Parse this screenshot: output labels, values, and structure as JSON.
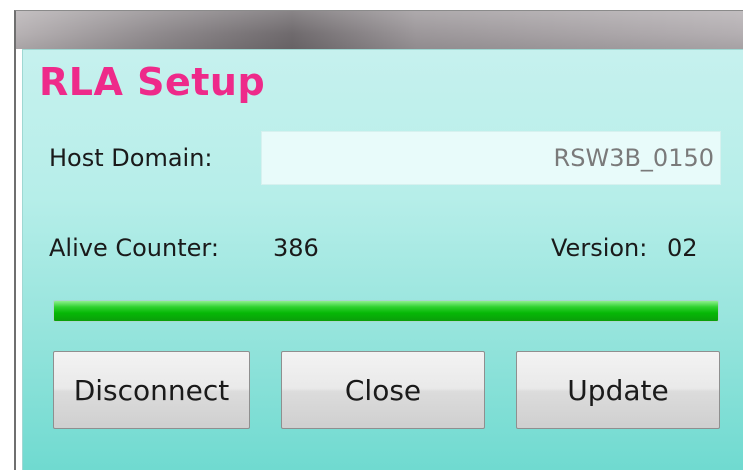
{
  "app": {
    "title": "RLA Setup"
  },
  "host": {
    "label": "Host Domain:",
    "value": "RSW3B_0150"
  },
  "status": {
    "alive_label": "Alive Counter:",
    "alive_value": "386",
    "version_label": "Version:",
    "version_value": "02"
  },
  "progress": {
    "fraction": 1.0
  },
  "buttons": {
    "disconnect": "Disconnect",
    "close": "Close",
    "update": "Update"
  },
  "colors": {
    "title": "#ee2a8a",
    "progress": "#06b806",
    "background_top": "#c6f1ee",
    "background_bottom": "#6fdad0"
  }
}
